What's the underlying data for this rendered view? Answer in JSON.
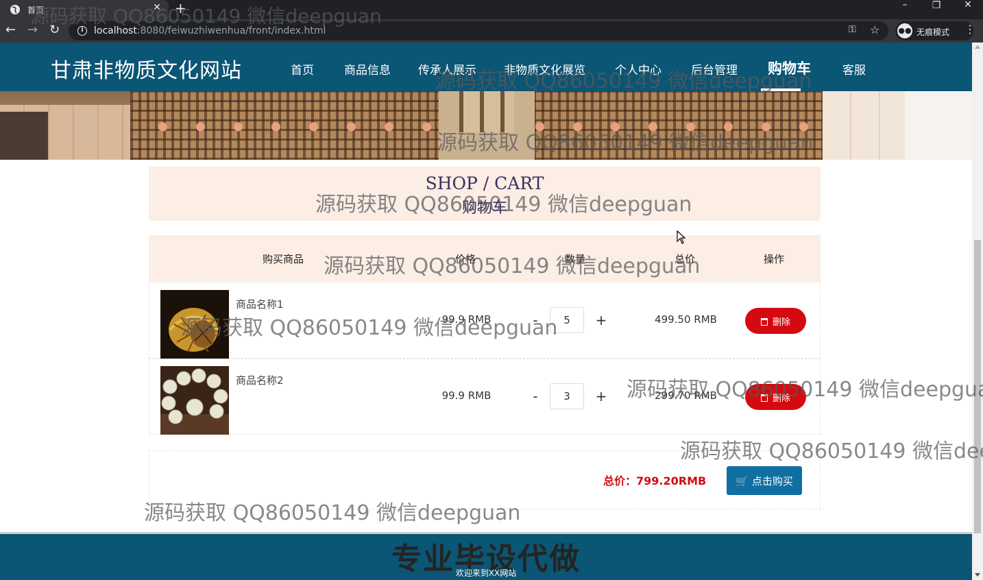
{
  "browser": {
    "tab_title": "首页",
    "tab_close": "✕",
    "new_tab": "+",
    "url_host": "localhost",
    "url_rest": ":8080/feiwuzhiwenhua/front/index.html",
    "incognito_label": "无痕模式",
    "window_controls": [
      "–",
      "❐",
      "✕"
    ]
  },
  "site": {
    "logo": "甘肃非物质文化网站",
    "nav": [
      {
        "label": "首页"
      },
      {
        "label": "商品信息"
      },
      {
        "label": "传承人展示"
      },
      {
        "label": "非物质文化展览"
      },
      {
        "label": "个人中心"
      },
      {
        "label": "后台管理"
      },
      {
        "label": "购物车",
        "active": true
      },
      {
        "label": "客服"
      }
    ]
  },
  "cart": {
    "title_en": "SHOP / CART",
    "title_zh": "购物车",
    "headers": {
      "product": "购买商品",
      "price": "价格",
      "quantity": "数量",
      "total": "总价",
      "action": "操作"
    },
    "items": [
      {
        "name": "商品名称1",
        "price": "99.9 RMB",
        "quantity": "5",
        "total": "499.50 RMB",
        "delete_label": "删除"
      },
      {
        "name": "商品名称2",
        "price": "99.9 RMB",
        "quantity": "3",
        "total": "299.70 RMB",
        "delete_label": "删除"
      }
    ],
    "minus": "-",
    "plus": "+",
    "grand_total": "总价：799.20RMB",
    "buy_label": "点击购买"
  },
  "footer": {
    "slogan": "专业毕设代做",
    "welcome": "欢迎来到XX网站"
  },
  "watermark": "源码获取 QQ86050149 微信deepguan",
  "colors": {
    "header_bg": "#0b5575",
    "delete_red": "#d40a10",
    "buy_blue": "#0f6fa3",
    "panel_bg": "#fcede5"
  }
}
